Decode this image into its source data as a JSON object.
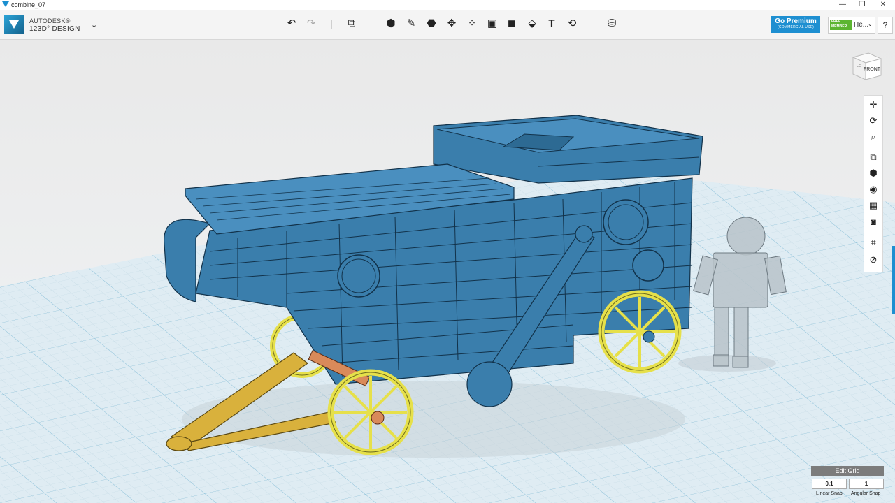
{
  "window": {
    "title": "combine_07",
    "minimize": "—",
    "restore": "❐",
    "close": "✕"
  },
  "app": {
    "brand_line1": "AUTODESK®",
    "brand_line2": "123D° DESIGN",
    "menu_chevron": "⌄"
  },
  "toolbar": {
    "undo_icon": "↶",
    "redo_icon": "↷",
    "tools": [
      {
        "name": "transform-icon",
        "glyph": "⧉"
      },
      {
        "name": "primitives-icon",
        "glyph": "⬢"
      },
      {
        "name": "sketch-icon",
        "glyph": "✎"
      },
      {
        "name": "construct-icon",
        "glyph": "⬣"
      },
      {
        "name": "modify-icon",
        "glyph": "✥"
      },
      {
        "name": "pattern-icon",
        "glyph": "⁘"
      },
      {
        "name": "group-icon",
        "glyph": "▣"
      },
      {
        "name": "combine-icon",
        "glyph": "◼"
      },
      {
        "name": "measure-icon",
        "glyph": "⬙"
      },
      {
        "name": "text-icon",
        "glyph": "T"
      },
      {
        "name": "snap-icon",
        "glyph": "⟲"
      },
      {
        "name": "material-icon",
        "glyph": "⛁"
      }
    ]
  },
  "account": {
    "premium_label": "Go Premium",
    "premium_sub": "(COMMERCIAL USE)",
    "free_badge_1": "FREE",
    "free_badge_2": "MEMBER",
    "user_name": "He...",
    "user_chevron": "⌄",
    "help_label": "?"
  },
  "viewcube": {
    "face_label": "FRONT",
    "side_label": "LE"
  },
  "nav_tools": [
    {
      "name": "pan-icon",
      "glyph": "✛"
    },
    {
      "name": "orbit-icon",
      "glyph": "⟳"
    },
    {
      "name": "zoom-icon",
      "glyph": "⌕"
    },
    {
      "name": "fit-icon",
      "glyph": "⧉"
    },
    {
      "name": "view-icon",
      "glyph": "⬢"
    },
    {
      "name": "visibility-icon",
      "glyph": "◉"
    },
    {
      "name": "materials-outline-icon",
      "glyph": "▦"
    },
    {
      "name": "camera-icon",
      "glyph": "◙"
    },
    {
      "name": "grid-icon",
      "glyph": "⌗"
    },
    {
      "name": "snap-grid-icon",
      "glyph": "⊘"
    }
  ],
  "grid": {
    "edit_label": "Edit Grid",
    "linear_snap_value": "0.1",
    "linear_snap_label": "Linear Snap",
    "angular_snap_value": "1",
    "angular_snap_label": "Angular Snap"
  },
  "colors": {
    "accent": "#1e8fd1",
    "model_body": "#3a7eac",
    "wheel": "#e6e04a",
    "drawbar": "#d9b13c",
    "axle": "#d98a5a",
    "figure": "#b9c3c9"
  }
}
